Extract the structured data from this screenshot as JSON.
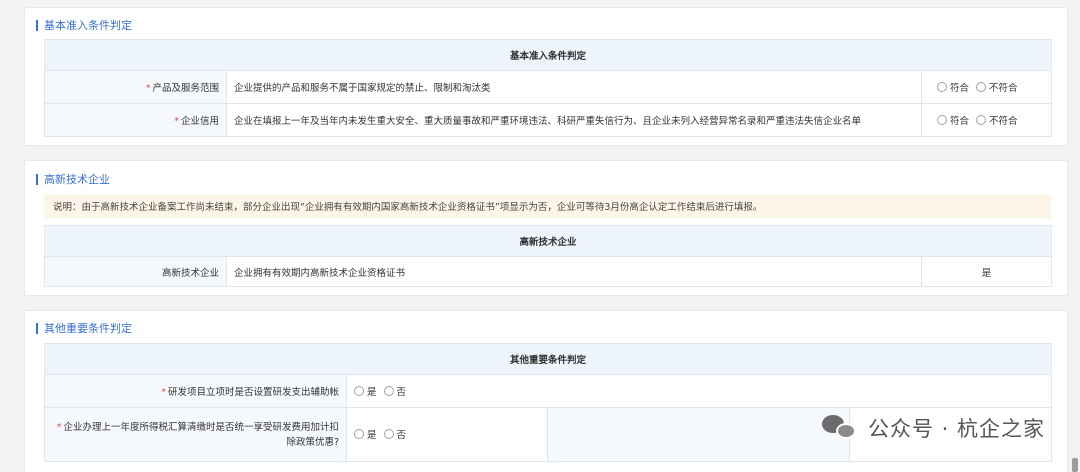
{
  "basic": {
    "section_title": "基本准入条件判定",
    "table_header": "基本准入条件判定",
    "rows": [
      {
        "required": "*",
        "label": "产品及服务范围",
        "content": "企业提供的产品和服务不属于国家规定的禁止、限制和淘汰类",
        "option_yes": "符合",
        "option_no": "不符合"
      },
      {
        "required": "*",
        "label": "企业信用",
        "content": "企业在填报上一年及当年内未发生重大安全、重大质量事故和严重环境违法、科研严重失信行为、且企业未列入经营异常名录和严重违法失信企业名单",
        "option_yes": "符合",
        "option_no": "不符合"
      }
    ]
  },
  "hightech": {
    "section_title": "高新技术企业",
    "notice": "说明：由于高新技术企业备案工作尚未结束，部分企业出现“企业拥有有效期内国家高新技术企业资格证书”项显示为否，企业可等待3月份高企认定工作结束后进行填报。",
    "table_header": "高新技术企业",
    "row": {
      "label": "高新技术企业",
      "content": "企业拥有有效期内高新技术企业资格证书",
      "value": "是"
    }
  },
  "other": {
    "section_title": "其他重要条件判定",
    "table_header": "其他重要条件判定",
    "rows": [
      {
        "required": "*",
        "label": "研发项目立项时是否设置研发支出辅助帐",
        "option_yes": "是",
        "option_no": "否"
      },
      {
        "required": "*",
        "label": "企业办理上一年度所得税汇算清缴时是否统一享受研发费用加计扣除政策优惠?",
        "option_yes": "是",
        "option_no": "否"
      }
    ]
  },
  "watermark": {
    "text": "公众号 · 杭企之家"
  }
}
